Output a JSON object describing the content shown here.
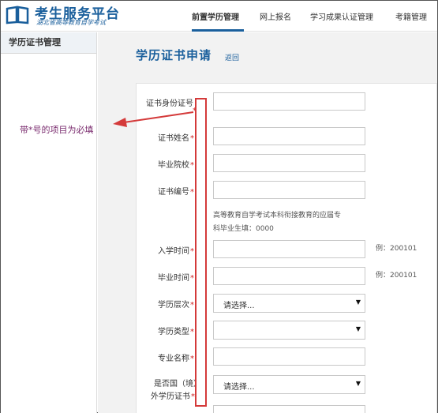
{
  "header": {
    "title": "考生服务平台",
    "subtitle": "湖北省高等教育自学考试",
    "nav": [
      {
        "label": "前置学历管理",
        "active": true
      },
      {
        "label": "网上报名",
        "active": false
      },
      {
        "label": "学习成果认证管理",
        "active": false
      },
      {
        "label": "考籍管理",
        "active": false
      }
    ]
  },
  "sidebar": {
    "items": [
      {
        "label": "学历证书管理"
      }
    ]
  },
  "main": {
    "title": "学历证书申请",
    "back_label": "返回"
  },
  "form": {
    "required_mark": "*",
    "fields": {
      "id_card": {
        "label": "证书身份证号"
      },
      "name": {
        "label": "证书姓名"
      },
      "school": {
        "label": "毕业院校"
      },
      "cert_no": {
        "label": "证书编号"
      },
      "hint": {
        "line1": "高等教育自学考试本科衔接教育的应届专",
        "line2": "科毕业生填：0000"
      },
      "enroll_time": {
        "label": "入学时间",
        "example": "例：200101"
      },
      "grad_time": {
        "label": "毕业时间",
        "example": "例：200101"
      },
      "level": {
        "label": "学历层次",
        "selected": "请选择..."
      },
      "type": {
        "label": "学历类型",
        "selected": ""
      },
      "major": {
        "label": "专业名称"
      },
      "foreign": {
        "label_line1": "是否国（境）",
        "label_line2": "外学历证书",
        "selected": "请选择..."
      }
    }
  },
  "annotation": {
    "note": "带*号的项目为必填"
  },
  "colors": {
    "brand": "#1a5f9c",
    "required": "#cc2222",
    "annotation": "#d43a3a"
  }
}
